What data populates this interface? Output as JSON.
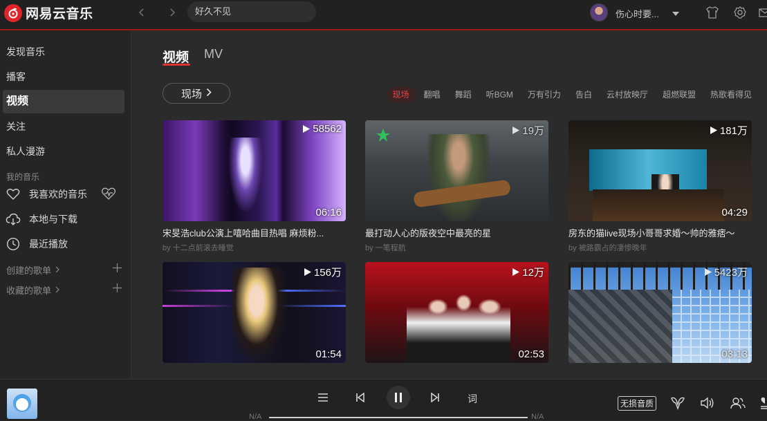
{
  "app": {
    "logo_text": "网易云音乐",
    "search_value": "好久不见",
    "user_name": "伤心时要...",
    "accent_color": "#e03333"
  },
  "sidebar": {
    "items": [
      {
        "label": "发现音乐"
      },
      {
        "label": "播客"
      },
      {
        "label": "视频",
        "active": true
      },
      {
        "label": "关注"
      },
      {
        "label": "私人漫游"
      }
    ],
    "my_music_header": "我的音乐",
    "my_music": [
      {
        "label": "我喜欢的音乐",
        "icon": "heart-icon"
      },
      {
        "label": "本地与下载",
        "icon": "cloud-download-icon"
      },
      {
        "label": "最近播放",
        "icon": "clock-icon"
      }
    ],
    "created_playlists": "创建的歌单",
    "collected_playlists": "收藏的歌单"
  },
  "main": {
    "tabs": [
      {
        "label": "视频",
        "active": true
      },
      {
        "label": "MV"
      }
    ],
    "category_button": "现场",
    "tags": [
      {
        "label": "现场",
        "active": true
      },
      {
        "label": "翻唱"
      },
      {
        "label": "舞蹈"
      },
      {
        "label": "听BGM"
      },
      {
        "label": "万有引力"
      },
      {
        "label": "告白"
      },
      {
        "label": "云村放映厅"
      },
      {
        "label": "超燃联盟"
      },
      {
        "label": "热歌看得见"
      }
    ],
    "videos": [
      {
        "plays": "58562",
        "duration": "06:16",
        "title": "宋旻浩club公演上嘻哈曲目热唱 麻烦粉...",
        "by_prefix": "by",
        "author": "十二点前滚去睡觉"
      },
      {
        "plays": "19万",
        "duration": "",
        "title": "最打动人心的版夜空中最亮的星",
        "by_prefix": "by",
        "author": "一笔程航"
      },
      {
        "plays": "181万",
        "duration": "04:29",
        "title": "房东的猫live现场小哥哥求婚～帅的雅痞～",
        "by_prefix": "by",
        "author": "被路霸占的凄惨晚年"
      },
      {
        "plays": "156万",
        "duration": "01:54",
        "title": "",
        "by_prefix": "",
        "author": ""
      },
      {
        "plays": "12万",
        "duration": "02:53",
        "title": "",
        "by_prefix": "",
        "author": ""
      },
      {
        "plays": "5423万",
        "duration": "03:13",
        "title": "",
        "by_prefix": "",
        "author": ""
      }
    ]
  },
  "player": {
    "time_current": "N/A",
    "time_total": "N/A",
    "lyric_button": "词",
    "quality_badge": "无损音质"
  }
}
